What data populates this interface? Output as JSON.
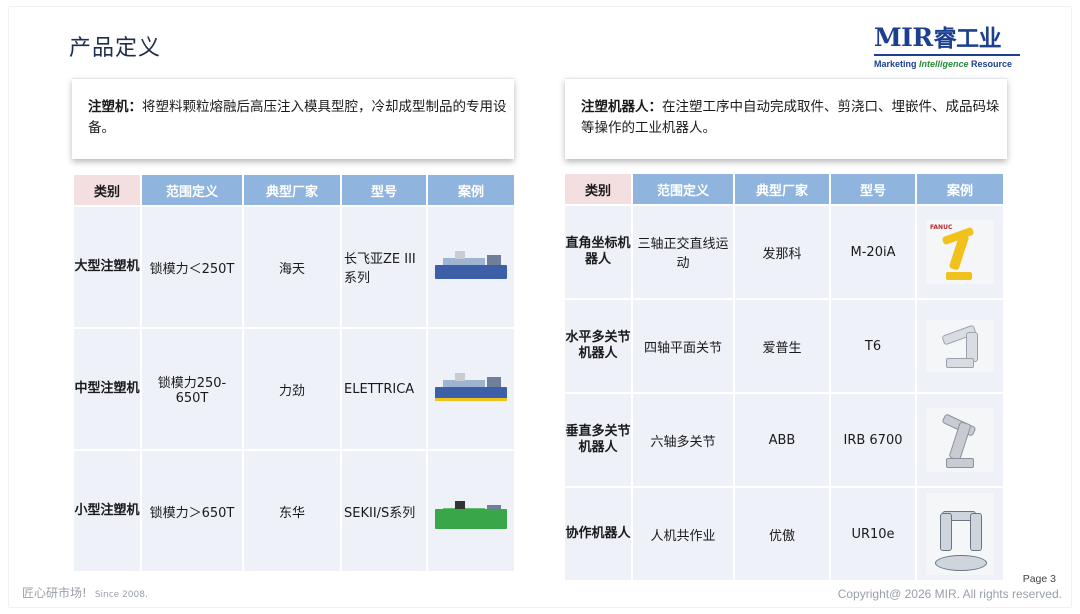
{
  "slide_title": "产品定义",
  "logo": {
    "main": "MIR",
    "suffix": "睿工业",
    "sub_pre": "Marketing ",
    "sub_int": "Intelligence",
    "sub_post": " Resource"
  },
  "left_definition": {
    "term": "注塑机",
    "colon": "：",
    "text": "将塑料颗粒熔融后高压注入模具型腔，冷却成型制品的专用设备。"
  },
  "right_definition": {
    "term": "注塑机器人",
    "colon": "：",
    "text": "在注塑工序中自动完成取件、剪浇口、埋嵌件、成品码垛等操作的工业机器人。"
  },
  "left_table": {
    "headers": [
      "类别",
      "范围定义",
      "典型厂家",
      "型号",
      "案例"
    ],
    "rows": [
      {
        "category": "大型注塑机",
        "range": "锁模力＜250T",
        "maker": "海天",
        "model": "长飞亚ZE III系列",
        "case_icon": "injection-machine-icon"
      },
      {
        "category": "中型注塑机",
        "range": "锁模力250-650T",
        "maker": "力劲",
        "model": "ELETTRICA",
        "case_icon": "injection-machine-icon"
      },
      {
        "category": "小型注塑机",
        "range": "锁模力＞650T",
        "maker": "东华",
        "model": "SEKII/S系列",
        "case_icon": "injection-machine-icon"
      }
    ]
  },
  "right_table": {
    "headers": [
      "类别",
      "范围定义",
      "典型厂家",
      "型号",
      "案例"
    ],
    "rows": [
      {
        "category": "直角坐标机器人",
        "range": "三轴正交直线运动",
        "maker": "发那科",
        "model": "M-20iA",
        "case_icon": "fanuc-robot-icon",
        "brand": "FANUC"
      },
      {
        "category": "水平多关节机器人",
        "range": "四轴平面关节",
        "maker": "爱普生",
        "model": "T6",
        "case_icon": "scara-robot-icon"
      },
      {
        "category": "垂直多关节机器人",
        "range": "六轴多关节",
        "maker": "ABB",
        "model": "IRB 6700",
        "case_icon": "six-axis-robot-icon"
      },
      {
        "category": "协作机器人",
        "range": "人机共作业",
        "maker": "优傲",
        "model": "UR10e",
        "case_icon": "cobot-icon"
      }
    ]
  },
  "footer": {
    "slogan": "匠心研市场!",
    "since": "Since 2008.",
    "page": "Page 3",
    "copyright": "Copyright@ 2026 MIR. All rights reserved."
  }
}
